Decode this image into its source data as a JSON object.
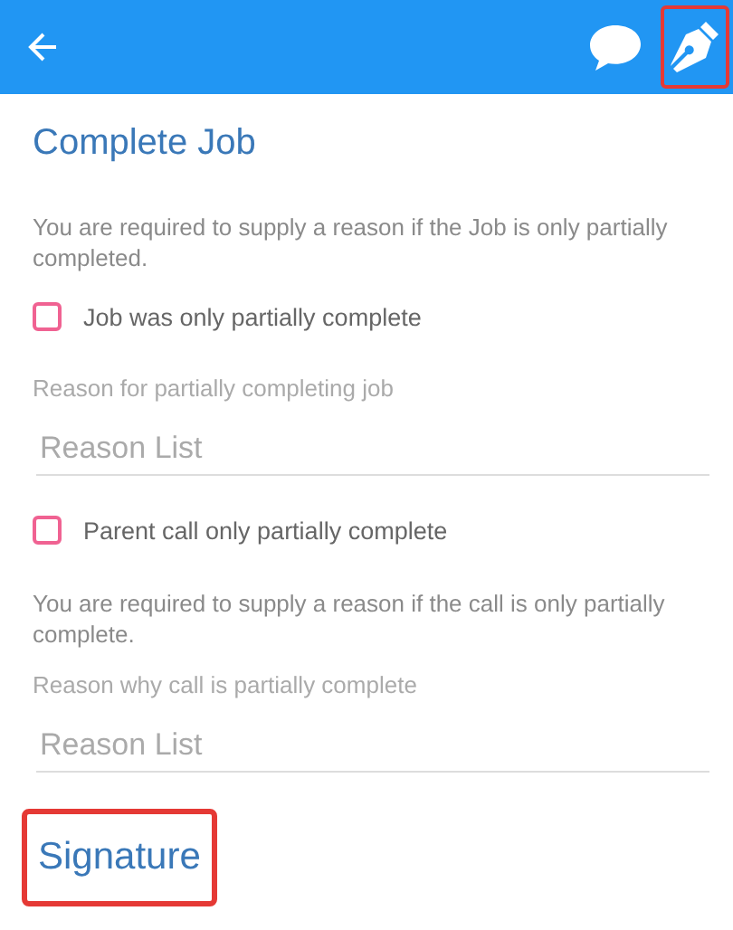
{
  "toolbar": {
    "actions": [
      {
        "kind": "comment",
        "highlighted": false
      },
      {
        "kind": "pen",
        "highlighted": true
      }
    ]
  },
  "title": "Complete Job",
  "items": [
    {
      "kind": "note",
      "text": "You are required to supply a reason if the Job is only partially completed."
    },
    {
      "kind": "checkbox",
      "text": "Job was only partially complete",
      "checked": false
    },
    {
      "kind": "label",
      "text": "Reason for partially completing job"
    },
    {
      "kind": "field",
      "placeholder": "Reason List"
    },
    {
      "kind": "checkbox",
      "text": "Parent call only partially complete",
      "checked": false
    },
    {
      "kind": "note",
      "text": "You are required to supply a reason if the call is only partially complete."
    },
    {
      "kind": "label",
      "text": "Reason why call is partially complete"
    },
    {
      "kind": "field",
      "placeholder": "Reason List"
    }
  ],
  "signature": {
    "text": "Signature",
    "highlighted": true
  }
}
